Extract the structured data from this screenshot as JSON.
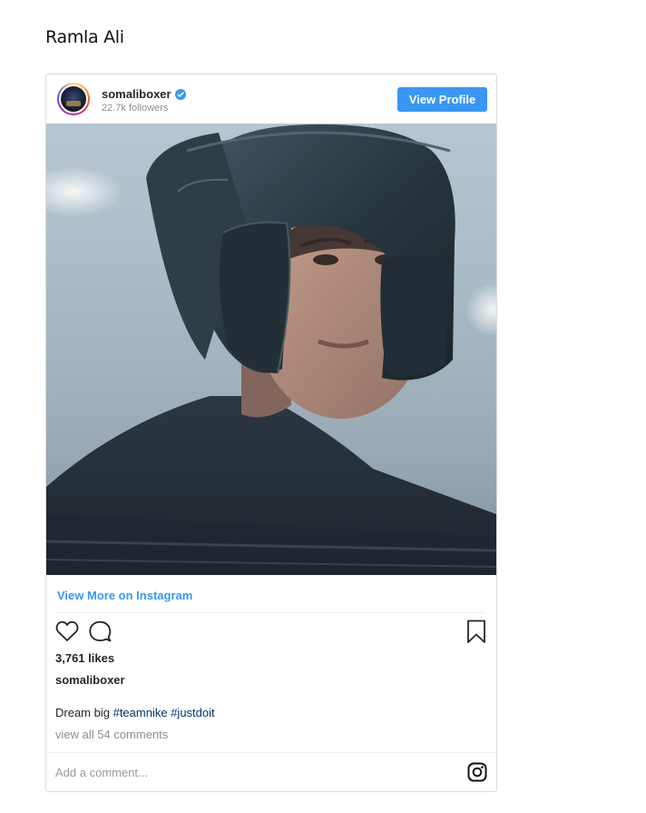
{
  "page": {
    "title": "Ramla Ali"
  },
  "post": {
    "username": "somaliboxer",
    "followers": "22.7k followers",
    "view_profile_label": "View Profile",
    "view_more_label": "View More on Instagram",
    "likes": "3,761 likes",
    "owner": "somaliboxer",
    "caption_text": "Dream big",
    "hashtags": [
      "#teamnike",
      "#justdoit"
    ],
    "view_comments": "view all 54 comments",
    "comment_placeholder": "Add a comment...",
    "photo_description_icon": "boxer-headgear-photo"
  },
  "colors": {
    "accent": "#3897f0",
    "hashtag": "#003569",
    "muted": "#8e8e8e"
  }
}
